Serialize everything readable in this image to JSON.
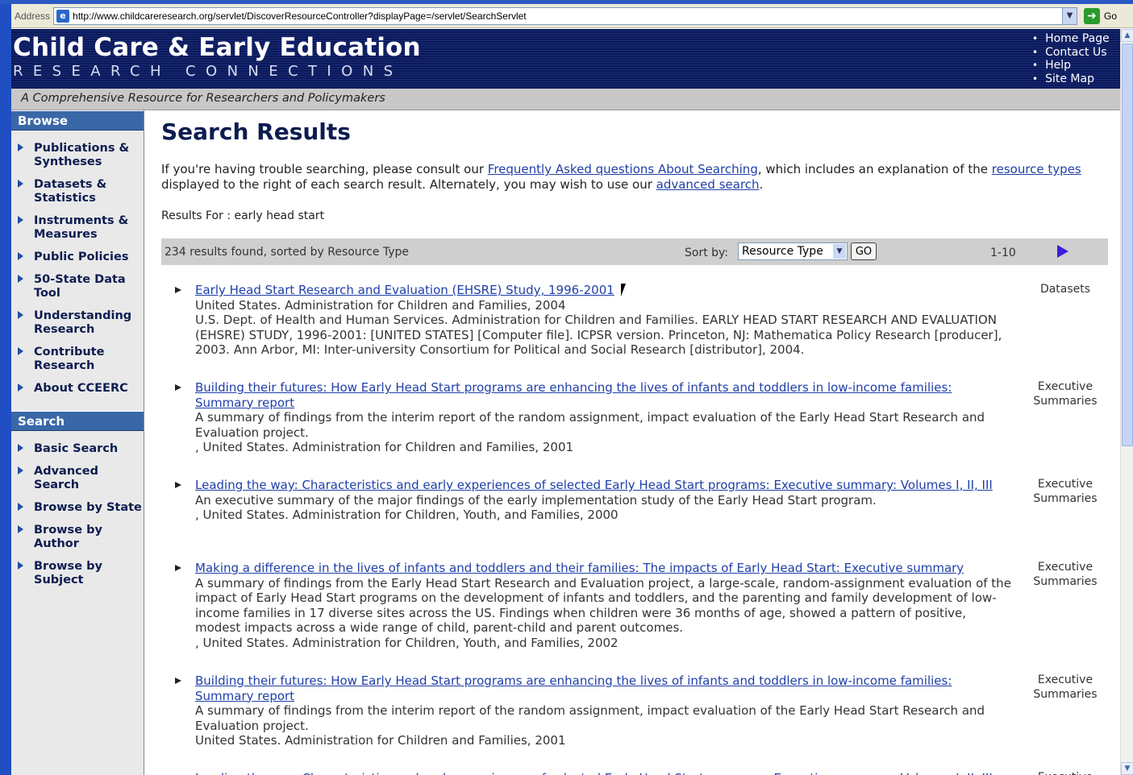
{
  "browser": {
    "address_label": "Address",
    "url": "http://www.childcareresearch.org/servlet/DiscoverResourceController?displayPage=/servlet/SearchServlet",
    "go_label": "Go"
  },
  "header": {
    "title": "Child Care & Early Education",
    "subtitle": "RESEARCH CONNECTIONS",
    "links": [
      "Home Page",
      "Contact Us",
      "Help",
      "Site Map"
    ],
    "tagline": "A Comprehensive Resource for Researchers and Policymakers"
  },
  "sidebar": {
    "browse_heading": "Browse",
    "browse_items": [
      "Publications & Syntheses",
      "Datasets & Statistics",
      "Instruments & Measures",
      "Public Policies",
      "50-State Data Tool",
      "Understanding Research",
      "Contribute Research",
      "About CCEERC"
    ],
    "search_heading": "Search",
    "search_items": [
      "Basic Search",
      "Advanced Search",
      "Browse by State",
      "Browse by Author",
      "Browse by Subject"
    ]
  },
  "main": {
    "title": "Search Results",
    "intro_prefix": "If you're having trouble searching, please consult our ",
    "faq_link": "Frequently Asked questions About Searching",
    "intro_mid": ", which includes an explanation of the ",
    "resource_types_link": "resource types",
    "intro_mid2": " displayed to the right of each search result. Alternately, you may wish to use our ",
    "advanced_link": "advanced search",
    "intro_end": ".",
    "results_for": "Results For : early head start",
    "count_text": "234 results found, sorted by Resource Type",
    "sort_label": "Sort by:",
    "sort_value": "Resource Type",
    "sort_go": "GO",
    "range": "1-10",
    "results": [
      {
        "title": "Early Head Start Research and Evaluation (EHSRE) Study, 1996-2001",
        "lines": [
          "United States. Administration for Children and Families, 2004",
          "U.S. Dept. of Health and Human Services. Administration for Children and Families. EARLY HEAD START RESEARCH AND EVALUATION (EHSRE) STUDY, 1996-2001: [UNITED STATES] [Computer file]. ICPSR version. Princeton, NJ: Mathematica Policy Research [producer], 2003. Ann Arbor, MI: Inter-university Consortium for Political and Social Research [distributor], 2004."
        ],
        "type": "Datasets"
      },
      {
        "title": "Building their futures: How Early Head Start programs are enhancing the lives of infants and toddlers in low-income families: Summary report",
        "lines": [
          "A summary of findings from the interim report of the random assignment, impact evaluation of the Early Head Start Research and Evaluation project.",
          ", United States. Administration for Children and Families, 2001"
        ],
        "type": "Executive Summaries"
      },
      {
        "title": "Leading the way: Characteristics and early experiences of selected Early Head Start programs: Executive summary: Volumes I, II, III",
        "lines": [
          "An executive summary of the major findings of the early implementation study of the Early Head Start program.",
          ", United States. Administration for Children, Youth, and Families, 2000"
        ],
        "type": "Executive Summaries"
      },
      {
        "title": "Making a difference in the lives of infants and toddlers and their families: The impacts of Early Head Start: Executive summary",
        "lines": [
          "A summary of findings from the Early Head Start Research and Evaluation project, a large-scale, random-assignment evaluation of the impact of Early Head Start programs on the development of infants and toddlers, and the parenting and family development of low-income families in 17 diverse sites across the US. Findings when children were 36 months of age, showed a pattern of positive, modest impacts across a wide range of child, parent-child and parent outcomes.",
          ", United States. Administration for Children, Youth, and Families, 2002"
        ],
        "type": "Executive Summaries"
      },
      {
        "title": "Building their futures: How Early Head Start programs are enhancing the lives of infants and toddlers in low-income families: Summary report",
        "lines": [
          "A summary of findings from the interim report of the random assignment, impact evaluation of the Early Head Start Research and Evaluation project.",
          "United States. Administration for Children and Families, 2001"
        ],
        "type": "Executive Summaries"
      },
      {
        "title": "Leading the way: Characteristics and early experiences of selected Early Head Start programs: Executive summary: Volumes I, II, III",
        "lines": [],
        "type": "Executive Summaries"
      }
    ]
  },
  "colors": {
    "banner": "#0b1957",
    "sidebar_heading": "#3a67a8",
    "link": "#1f3fa8",
    "sortbar": "#cfcfcf",
    "next_arrow": "#3a1ee0"
  },
  "icons": {
    "favicon": "ie-page-icon",
    "go": "go-arrow-icon",
    "next": "next-page-icon"
  }
}
